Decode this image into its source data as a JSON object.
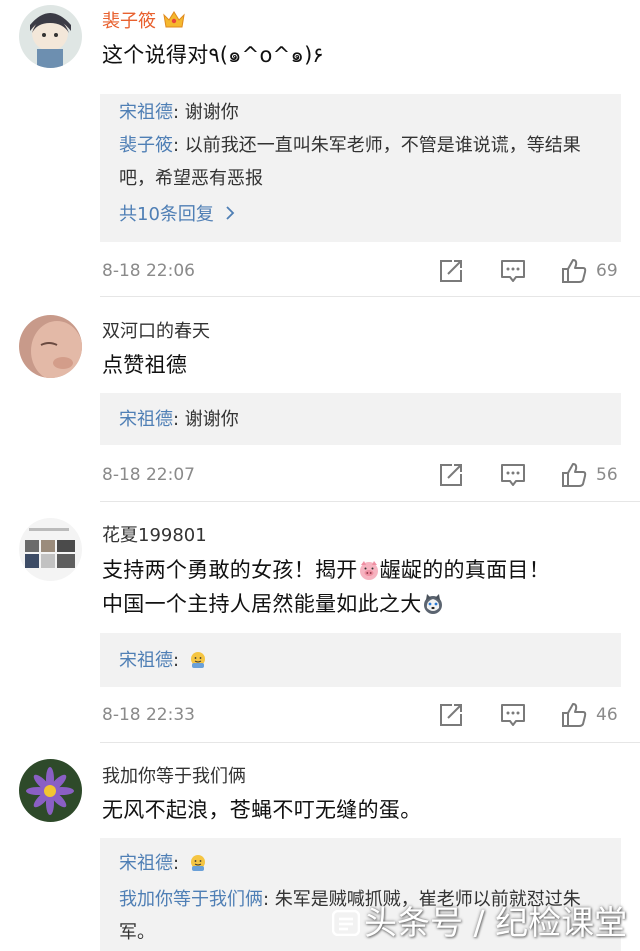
{
  "comments": [
    {
      "username": "裴子筱",
      "text": "这个说得对٩(๑^o^๑)۶",
      "replies": [
        {
          "name": "宋祖德",
          "text": ": 谢谢你"
        },
        {
          "name": "裴子筱",
          "text": ": 以前我还一直叫朱军老师，不管是谁说谎，等结果吧，希望恶有恶报"
        }
      ],
      "more_replies": "共10条回复",
      "time": "8-18 22:06",
      "likes": "69"
    },
    {
      "username": "双河口的春天",
      "text": "点赞祖德",
      "replies": [
        {
          "name": "宋祖德",
          "text": ": 谢谢你"
        }
      ],
      "time": "8-18 22:07",
      "likes": "56"
    },
    {
      "username": "花夏199801",
      "text_line1": "支持两个勇敢的女孩！揭开",
      "text_line1b": "龌龊的的真面目！",
      "text_line2": "中国一个主持人居然能量如此之大",
      "replies": [
        {
          "name": "宋祖德",
          "text": ":"
        }
      ],
      "time": "8-18 22:33",
      "likes": "46"
    },
    {
      "username": "我加你等于我们俩",
      "text": "无风不起浪，苍蝇不叮无缝的蛋。",
      "replies": [
        {
          "name": "宋祖德",
          "text": ":"
        },
        {
          "name": "我加你等于我们俩",
          "text": ": 朱军是贼喊抓贼，崔老师以前就怼过朱军。"
        }
      ]
    }
  ],
  "watermark": "头条号 / 纪检课堂",
  "icons": {
    "crown": "vip-crown-icon",
    "share": "share-icon",
    "reply": "comment-icon",
    "like": "thumbs-up-icon"
  },
  "colors": {
    "username_vip": "#e8612f",
    "reply_name": "#4f7fb5",
    "meta": "#8a8a8a",
    "reply_bg": "#f2f2f2"
  }
}
